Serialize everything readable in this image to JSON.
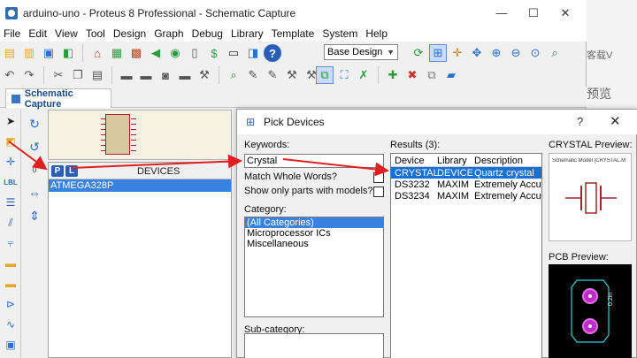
{
  "window": {
    "title": "arduino-uno - Proteus 8 Professional - Schematic Capture",
    "minimize": "—",
    "maximize": "☐",
    "close": "✕"
  },
  "menu": [
    "File",
    "Edit",
    "View",
    "Tool",
    "Design",
    "Graph",
    "Debug",
    "Library",
    "Template",
    "System",
    "Help"
  ],
  "toolbar": {
    "design_select": "Base Design"
  },
  "tab": {
    "label": "Schematic Capture"
  },
  "devices_panel": {
    "title": "DEVICES",
    "p_button": "P",
    "l_button": "L",
    "items": [
      "ATMEGA328P"
    ]
  },
  "dialog": {
    "title": "Pick Devices",
    "help": "?",
    "close": "✕",
    "keywords_label": "Keywords:",
    "keywords_value": "Crystal",
    "match_whole_words": "Match Whole Words?",
    "show_only_models": "Show only parts with models?",
    "category_label": "Category:",
    "categories": [
      "(All Categories)",
      "Microprocessor ICs",
      "Miscellaneous"
    ],
    "subcategory_label": "Sub-category:",
    "results_label": "Results (3):",
    "results_columns": [
      "Device",
      "Library",
      "Description"
    ],
    "results": [
      {
        "device": "CRYSTAL",
        "library": "DEVICE",
        "description": "Quartz crystal"
      },
      {
        "device": "DS3232",
        "library": "MAXIM",
        "description": "Extremely Accurate"
      },
      {
        "device": "DS3234",
        "library": "MAXIM",
        "description": "Extremely Accurate"
      }
    ],
    "preview_label": "CRYSTAL Preview:",
    "preview_model": "Schematic Model [CRYSTAL.M",
    "pcb_label": "PCB Preview:",
    "pcb_text": "0.2in"
  },
  "background_window": {
    "text1": "客载V",
    "text2": "预览"
  },
  "colors": {
    "selection": "#3a82e0",
    "arrow": "#e02020",
    "pcb_pad": "#c12cc9"
  }
}
